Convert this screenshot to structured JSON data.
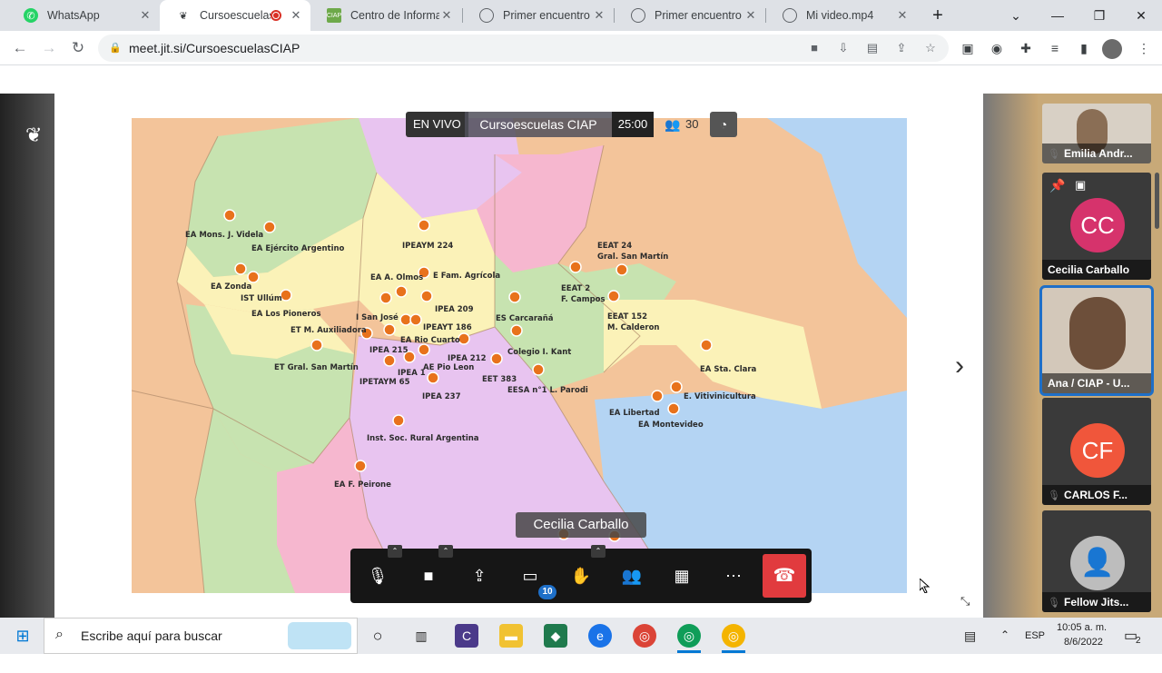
{
  "browser": {
    "tabs": [
      {
        "title": "WhatsApp",
        "active": false,
        "favicon": "whatsapp-icon"
      },
      {
        "title": "Cursoescuelas",
        "active": true,
        "favicon": "jitsi-icon"
      },
      {
        "title": "Centro de Informac",
        "active": false,
        "favicon": "ciap-icon"
      },
      {
        "title": "Primer encuentro 8",
        "active": false,
        "favicon": "globe-icon"
      },
      {
        "title": "Primer encuentro 8",
        "active": false,
        "favicon": "globe-icon"
      },
      {
        "title": "Mi video.mp4",
        "active": false,
        "favicon": "globe-icon"
      }
    ],
    "url": "meet.jit.si/CursoescuelasCIAP"
  },
  "meeting": {
    "live_label": "EN VIVO",
    "name": "Cursoescuelas CIAP",
    "timer": "25:00",
    "participant_count": "30",
    "speaker_label": "Cecilia Carballo",
    "chat_badge": "10"
  },
  "map": {
    "labels": [
      "EA Mons. J. Videla",
      "EA Ejército Argentino",
      "EA Zonda",
      "IST Ullúm",
      "EA Los Pioneros",
      "ET M. Auxiliadora",
      "ET Gral. San Martín",
      "IPEAYM 224",
      "EA A. Olmos",
      "E Fam. Agrícola",
      "I San José",
      "IPEA 209",
      "IPEAYT 186",
      "EA Rio Cuarto",
      "IPEA 215",
      "IPEA 212",
      "IPEA 1",
      "AE Pio Leon",
      "IPETAYM 65",
      "IPEA 237",
      "Inst. Soc. Rural Argentina",
      "EA F. Peirone",
      "ES Carcarañá",
      "Colegio I. Kant",
      "EET 383",
      "EESA n°1 L. Parodi",
      "EEAT 24",
      "Gral. San Martín",
      "EEAT 2",
      "F. Campos",
      "EEAT 152",
      "M. Calderon",
      "EA Sta. Clara",
      "E. Vitivinicultura",
      "EA Libertad",
      "EA Montevideo"
    ]
  },
  "filmstrip": [
    {
      "name": "Emilia Andr...",
      "initials": "",
      "muted": true,
      "color": "#a88f6a"
    },
    {
      "name": "Cecilia Carballo",
      "initials": "CC",
      "muted": false,
      "color": "#d6336c"
    },
    {
      "name": "Ana / CIAP - U...",
      "initials": "",
      "muted": false,
      "color": "#8a7560"
    },
    {
      "name": "CARLOS F...",
      "initials": "CF",
      "muted": true,
      "color": "#f0563b"
    },
    {
      "name": "Fellow Jits...",
      "initials": "",
      "muted": true,
      "color": "#bdbdbd"
    }
  ],
  "taskbar": {
    "search_placeholder": "Escribe aquí para buscar",
    "language": "ESP",
    "time": "10:05 a. m.",
    "date": "8/6/2022",
    "notifications": "2"
  }
}
